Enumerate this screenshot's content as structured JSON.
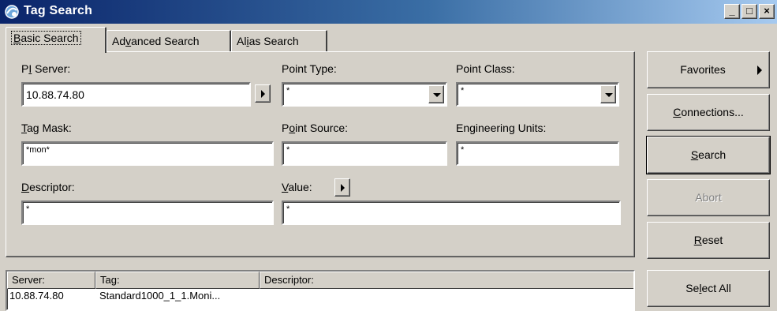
{
  "window": {
    "title": "Tag Search",
    "icon": "tag-search-app-icon",
    "controls": [
      "_",
      "□",
      "×"
    ]
  },
  "tabs": [
    {
      "label_pre": "",
      "label_u": "B",
      "label_post": "asic Search",
      "active": true
    },
    {
      "label_pre": "Ad",
      "label_u": "v",
      "label_post": "anced Search",
      "active": false
    },
    {
      "label_pre": "Al",
      "label_u": "i",
      "label_post": "as Search",
      "active": false
    }
  ],
  "form": {
    "pi_server": {
      "label_pre": "P",
      "label_u": "I",
      "label_post": " Server:",
      "value": "10.88.74.80"
    },
    "point_type": {
      "label": "Point Type:",
      "value": "*"
    },
    "point_class": {
      "label": "Point Class:",
      "value": "*"
    },
    "tag_mask": {
      "label_u": "T",
      "label_post": "ag Mask:",
      "value": "*mon*"
    },
    "point_source": {
      "label_pre": "P",
      "label_u": "o",
      "label_post": "int Source:",
      "value": "*"
    },
    "engineering_units": {
      "label": "Engineering Units:",
      "value": "*"
    },
    "descriptor": {
      "label_u": "D",
      "label_post": "escriptor:",
      "value": "*"
    },
    "value": {
      "label_u": "V",
      "label_post": "alue:",
      "value": "*"
    }
  },
  "buttons": {
    "favorites": "Favorites",
    "connections_u": "C",
    "connections_post": "onnections...",
    "search_u": "S",
    "search_post": "earch",
    "abort": "Abort",
    "reset_u": "R",
    "reset_post": "eset",
    "select_all_pre": "Se",
    "select_all_u": "l",
    "select_all_post": "ect All"
  },
  "results": {
    "columns": [
      "Server:",
      "Tag:",
      "Descriptor:"
    ],
    "rows": [
      {
        "server": "10.88.74.80",
        "tag": "Standard1000_1_1.Moni...",
        "descriptor": ""
      }
    ]
  },
  "colors": {
    "titlebar_start": "#0a246a",
    "titlebar_end": "#a6caf0",
    "face": "#d4d0c8"
  }
}
